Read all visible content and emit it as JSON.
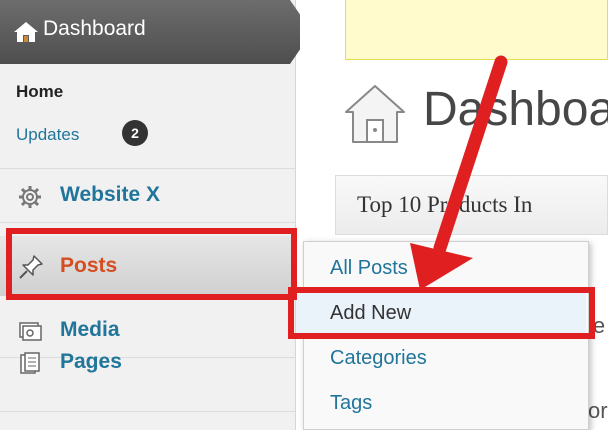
{
  "sidebar": {
    "dashboard_label": "Dashboard",
    "home_label": "Home",
    "updates_label": "Updates",
    "updates_count": "2",
    "items": [
      {
        "label": "Website X",
        "icon": "gear-icon"
      },
      {
        "label": "Posts",
        "icon": "pushpin-icon"
      },
      {
        "label": "Media",
        "icon": "media-icon"
      },
      {
        "label": "Pages",
        "icon": "pages-icon"
      }
    ]
  },
  "main": {
    "page_title": "Dashboa",
    "widget_title": "Top 10 Products In",
    "fragments": [
      "le",
      "or"
    ]
  },
  "flyout": {
    "items": [
      "All Posts",
      "Add New",
      "Categories",
      "Tags"
    ],
    "active_index": 1
  },
  "annotation": {
    "highlight_color": "#e02020"
  }
}
